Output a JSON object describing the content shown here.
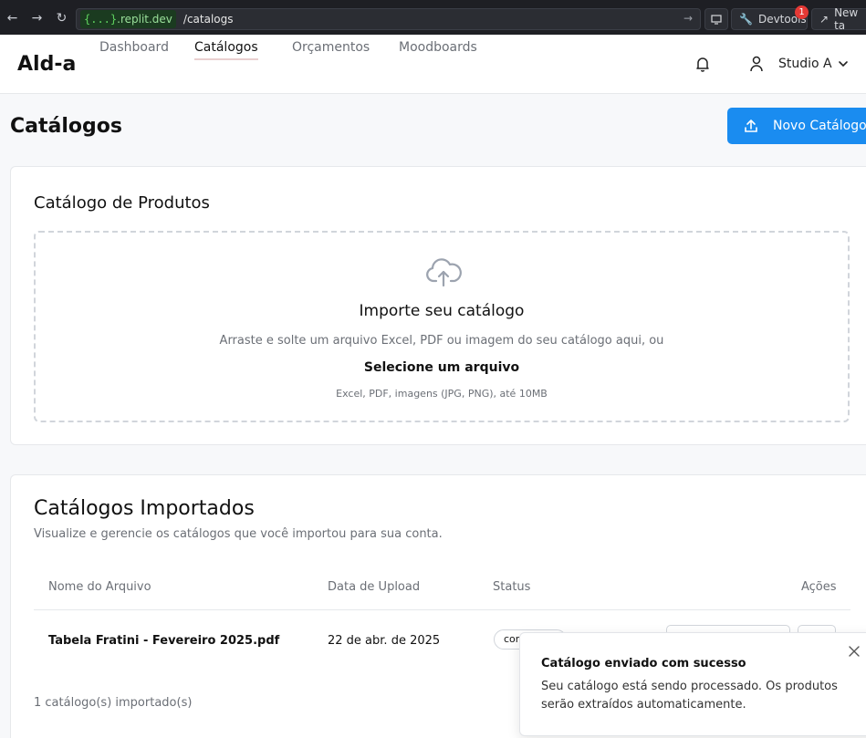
{
  "browser": {
    "url_host_token": "{...}",
    "url_host_rest": ".replit.dev",
    "url_path": "/catalogs",
    "devtools_label": "Devtools",
    "devtools_badge": "1",
    "new_tab_label": "New ta"
  },
  "header": {
    "logo": "Ald-a",
    "tabs": [
      {
        "label": "Dashboard"
      },
      {
        "label": "Catálogos"
      },
      {
        "label": "Orçamentos"
      },
      {
        "label": "Moodboards"
      }
    ],
    "user_name": "Studio A"
  },
  "page": {
    "title": "Catálogos",
    "new_button_label": "Novo Catálogo"
  },
  "upload_card": {
    "title": "Catálogo de Produtos",
    "dropzone_title": "Importe seu catálogo",
    "dropzone_desc": "Arraste e solte um arquivo Excel, PDF ou imagem do seu catálogo aqui, ou",
    "dropzone_link": "Selecione um arquivo",
    "dropzone_hint": "Excel, PDF, imagens (JPG, PNG), até 10MB"
  },
  "imported_card": {
    "title": "Catálogos Importados",
    "subtitle": "Visualize e gerencie os catálogos que você importou para sua conta.",
    "columns": [
      "Nome do Arquivo",
      "Data de Upload",
      "Status",
      "Ações"
    ],
    "rows": [
      {
        "file": "Tabela Fratini - Fevereiro 2025.pdf",
        "date": "22 de abr. de 2025",
        "status": "concluído"
      }
    ],
    "count_text": "1 catálogo(s) importado(s)"
  },
  "toast": {
    "title": "Catálogo enviado com sucesso",
    "description": "Seu catálogo está sendo processado. Os produtos serão extraídos automaticamente."
  },
  "colors": {
    "primary": "#1a8cf0",
    "active_tab_underline": "#e9cfcf"
  }
}
